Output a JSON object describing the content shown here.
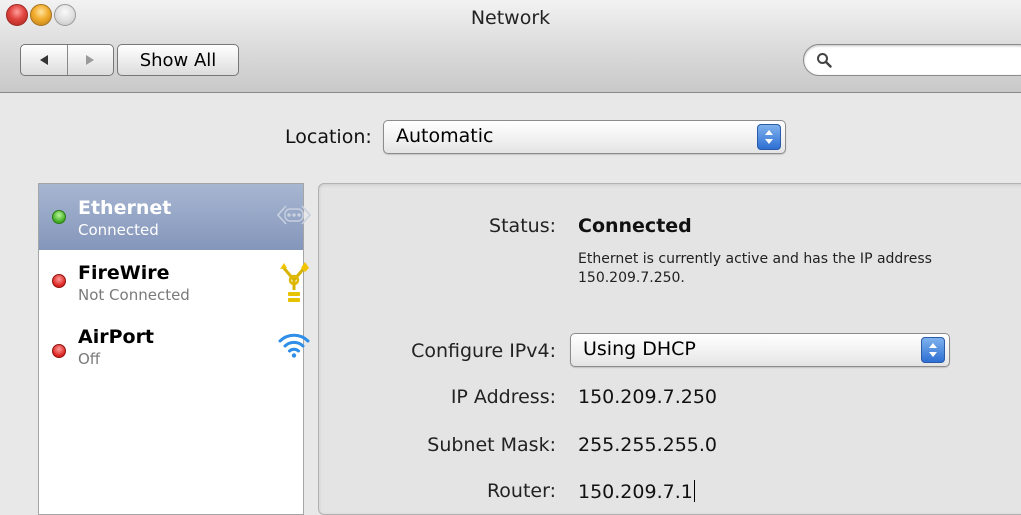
{
  "window": {
    "title": "Network",
    "show_all_label": "Show All",
    "search": {
      "placeholder": "",
      "value": ""
    }
  },
  "location": {
    "label": "Location:",
    "value": "Automatic"
  },
  "services": [
    {
      "name": "Ethernet",
      "status": "Connected",
      "status_color": "#3dab1f",
      "icon": "ethernet-icon",
      "selected": true
    },
    {
      "name": "FireWire",
      "status": "Not Connected",
      "status_color": "#d9201b",
      "icon": "firewire-icon",
      "selected": false
    },
    {
      "name": "AirPort",
      "status": "Off",
      "status_color": "#d9201b",
      "icon": "airport-wifi-icon",
      "selected": false
    }
  ],
  "detail": {
    "status_label": "Status:",
    "status_value": "Connected",
    "status_desc": "Ethernet is currently active and has the IP address 150.209.7.250.",
    "configure_label": "Configure IPv4:",
    "configure_value": "Using DHCP",
    "ip_label": "IP Address:",
    "ip_value": "150.209.7.250",
    "subnet_label": "Subnet Mask:",
    "subnet_value": "255.255.255.0",
    "router_label": "Router:",
    "router_value": "150.209.7.1"
  },
  "colors": {
    "selection": "#8f9fc2",
    "accent_blue": "#2d6fd3"
  }
}
